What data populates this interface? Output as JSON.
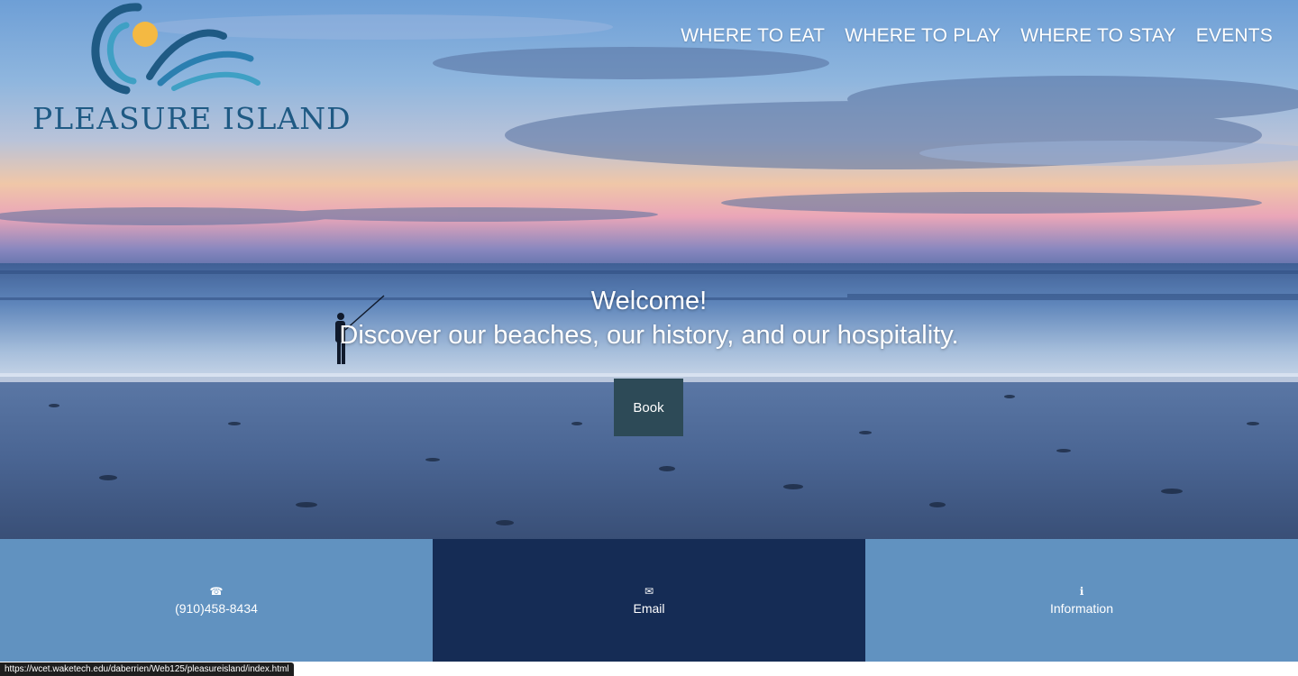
{
  "logo": {
    "text": "PLEASURE ISLAND",
    "colors": {
      "wave_dark": "#1f5a84",
      "wave_light": "#3fa0c4",
      "sun": "#f4b942"
    }
  },
  "nav": {
    "items": [
      {
        "label": "WHERE TO EAT"
      },
      {
        "label": "WHERE TO PLAY"
      },
      {
        "label": "WHERE TO STAY"
      },
      {
        "label": "EVENTS"
      }
    ]
  },
  "hero": {
    "title": "Welcome!",
    "subtitle": "Discover our beaches, our history, and our hospitality.",
    "book_label": "Book"
  },
  "contact": {
    "phone": {
      "icon": "phone-icon",
      "glyph": "☎",
      "label": "(910)458-8434"
    },
    "email": {
      "icon": "envelope-icon",
      "glyph": "✉",
      "label": "Email"
    },
    "info": {
      "icon": "info-icon",
      "glyph": "ℹ",
      "label": "Information"
    }
  },
  "status_bar": {
    "url": "https://wcet.waketech.edu/daberrien/Web125/pleasureisland/index.html"
  },
  "colors": {
    "contact_light": "#6192c0",
    "contact_dark": "#152c55",
    "book_button": "#2d4a57",
    "ocean": "#4e76a8",
    "sand": "#3b5378"
  }
}
